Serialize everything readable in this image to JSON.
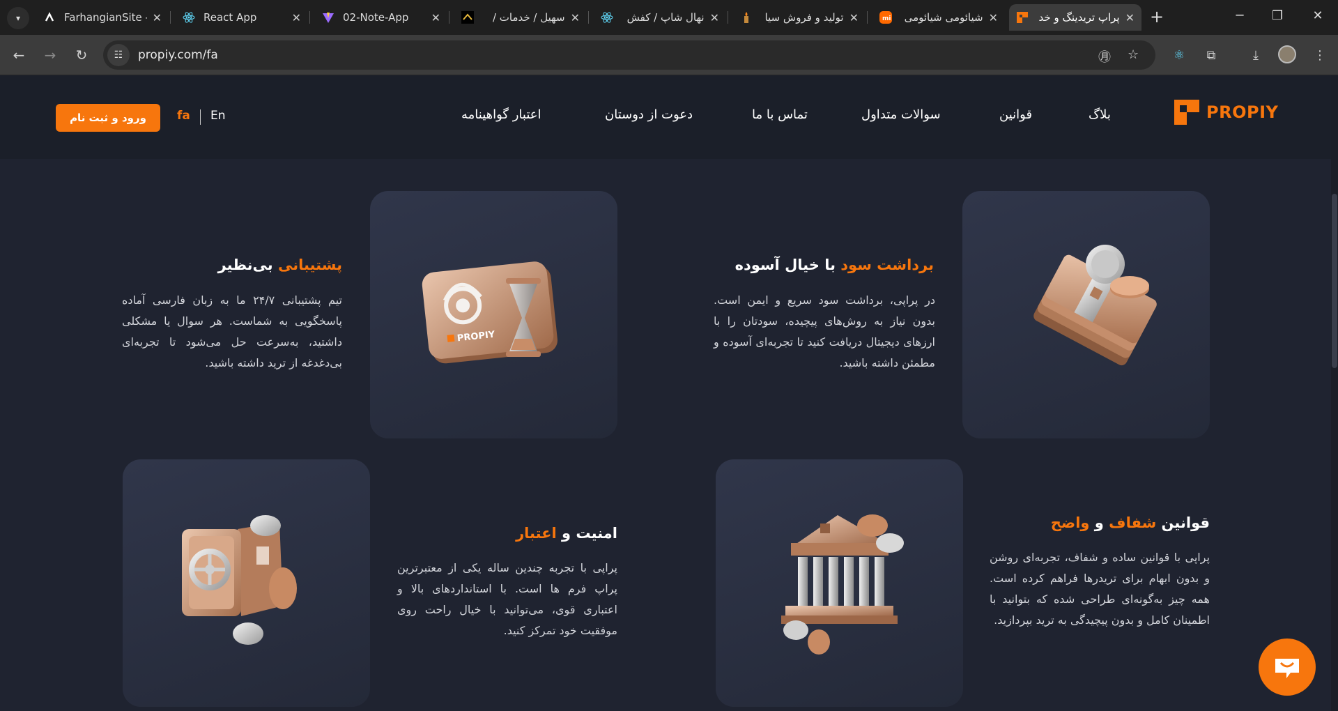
{
  "browser": {
    "tabs": [
      {
        "title": "FarhangianSite -",
        "favicon": "farhangian-icon"
      },
      {
        "title": "React App",
        "favicon": "react-icon"
      },
      {
        "title": "02-Note-App",
        "favicon": "vite-icon"
      },
      {
        "title": "سهیل / خدمات /",
        "favicon": "site-icon"
      },
      {
        "title": "نهال شاپ / کفش",
        "favicon": "react-icon"
      },
      {
        "title": "تولید و فروش سیا",
        "favicon": "candle-icon"
      },
      {
        "title": "شیائومی شیائومی",
        "favicon": "mi-icon"
      },
      {
        "title": "پراپ تریدینگ و خد",
        "favicon": "propiy-icon",
        "active": true
      }
    ],
    "new_tab": "+",
    "url": "propiy.com/fa"
  },
  "header": {
    "logo_text": "PROPIY",
    "nav": [
      "بلاگ",
      "قوانین",
      "سوالات متداول",
      "تماس با ما",
      "دعوت از دوستان",
      "اعتبار گواهینامه"
    ],
    "lang_fa": "fa",
    "lang_en": "En",
    "login_label": "ورود و ثبت نام"
  },
  "features": [
    {
      "title_orange": "برداشت سود",
      "title_white": " با خیال آسوده",
      "description": "در پراپی، برداشت سود سریع و ایمن است. بدون نیاز به روش‌های پیچیده، سودتان را با ارزهای دیجیتال دریافت کنید تا تجربه‌ای آسوده و مطمئن داشته باشید.",
      "image": "money-stack-icon"
    },
    {
      "title_orange": "پشتیبانی",
      "title_white": " بی‌نظیر",
      "description": "تیم پشتیبانی ۲۴/۷ ما به زبان فارسی آماده پاسخگویی به شماست. هر سوال یا مشکلی داشتید، به‌سرعت حل می‌شود تا تجربه‌ای بی‌دغدغه از ترید داشته باشید.",
      "image": "support-hourglass-icon",
      "image_logo": "PROPIY"
    },
    {
      "title_white1": "قوانین ",
      "title_orange1": "شفاف",
      "title_white2": " و ",
      "title_orange2": "واضح",
      "description": "پراپی با قوانین ساده و شفاف، تجربه‌ای روشن و بدون ابهام برای تریدرها فراهم کرده است. همه چیز به‌گونه‌ای طراحی شده که بتوانید با اطمینان کامل و بدون پیچیدگی به ترید بپردازید.",
      "image": "bank-building-icon"
    },
    {
      "title_white": "امنیت و ",
      "title_orange": "اعتبار",
      "description": "پراپی با تجربه چندین ساله یکی از معتبرترین پراپ فرم ها است. با استانداردهای بالا و اعتباری قوی، می‌توانید با خیال راحت روی موفقیت خود تمرکز کنید.",
      "image": "safe-icon"
    }
  ],
  "colors": {
    "accent": "#f7760d",
    "background": "#1f2330",
    "card": "#2b3041"
  }
}
